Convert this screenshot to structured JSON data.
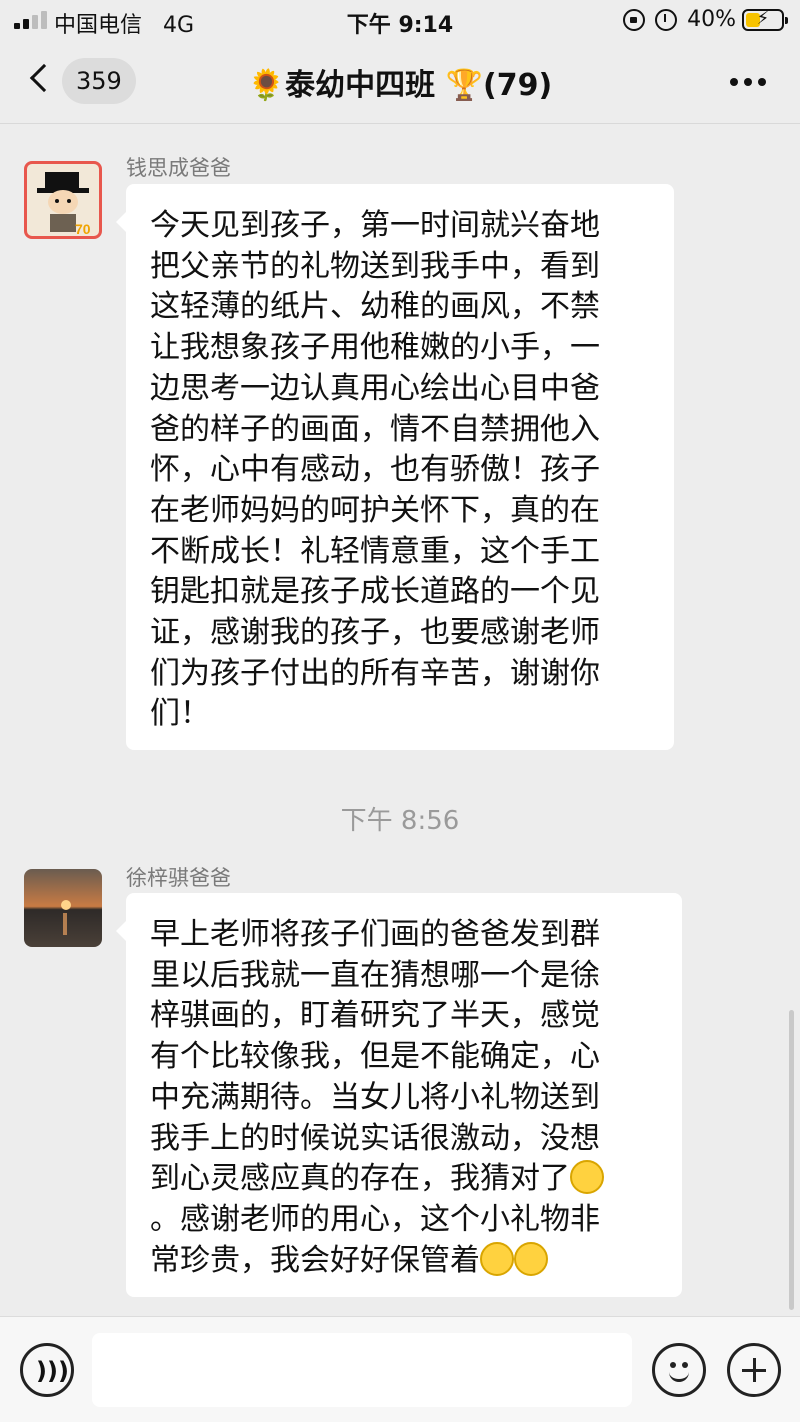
{
  "status_bar": {
    "carrier": "中国电信",
    "network": "4G",
    "time": "下午 9:14",
    "battery_percent": "40%",
    "battery_level": 0.4,
    "battery_color": "#f7c300",
    "battery_bolt": "⚡"
  },
  "nav": {
    "unread_count": "359",
    "title": "🌻泰幼中四班 🏆(79)"
  },
  "messages": [
    {
      "sender": "钱思成爸爸",
      "avatar_icon": "person-in-hat-avatar",
      "lines": [
        "今天见到孩子，第一时间就兴奋地",
        "把父亲节的礼物送到我手中，看到",
        "这轻薄的纸片、幼稚的画风，不禁",
        "让我想象孩子用他稚嫩的小手，一",
        "边思考一边认真用心绘出心目中爸",
        "爸的样子的画面，情不自禁拥他入",
        "怀，心中有感动，也有骄傲！孩子",
        "在老师妈妈的呵护关怀下，真的在",
        "不断成长！礼轻情意重，这个手工",
        "钥匙扣就是孩子成长道路的一个见",
        "证，感谢我的孩子，也要感谢老师",
        "们为孩子付出的所有辛苦，谢谢你",
        "们！"
      ]
    },
    {
      "sender": "徐梓骐爸爸",
      "avatar_icon": "sunset-avatar",
      "lines": [
        "早上老师将孩子们画的爸爸发到群",
        "里以后我就一直在猜想哪一个是徐",
        "梓骐画的，盯着研究了半天，感觉",
        "有个比较像我，但是不能确定，心",
        "中充满期待。当女儿将小礼物送到",
        "我手上的时候说实话很激动，没想",
        "到心灵感应真的存在，我猜对了",
        "。感谢老师的用心，这个小礼物非",
        "常珍贵，我会好好保管着"
      ]
    }
  ],
  "time_divider": "下午 8:56"
}
